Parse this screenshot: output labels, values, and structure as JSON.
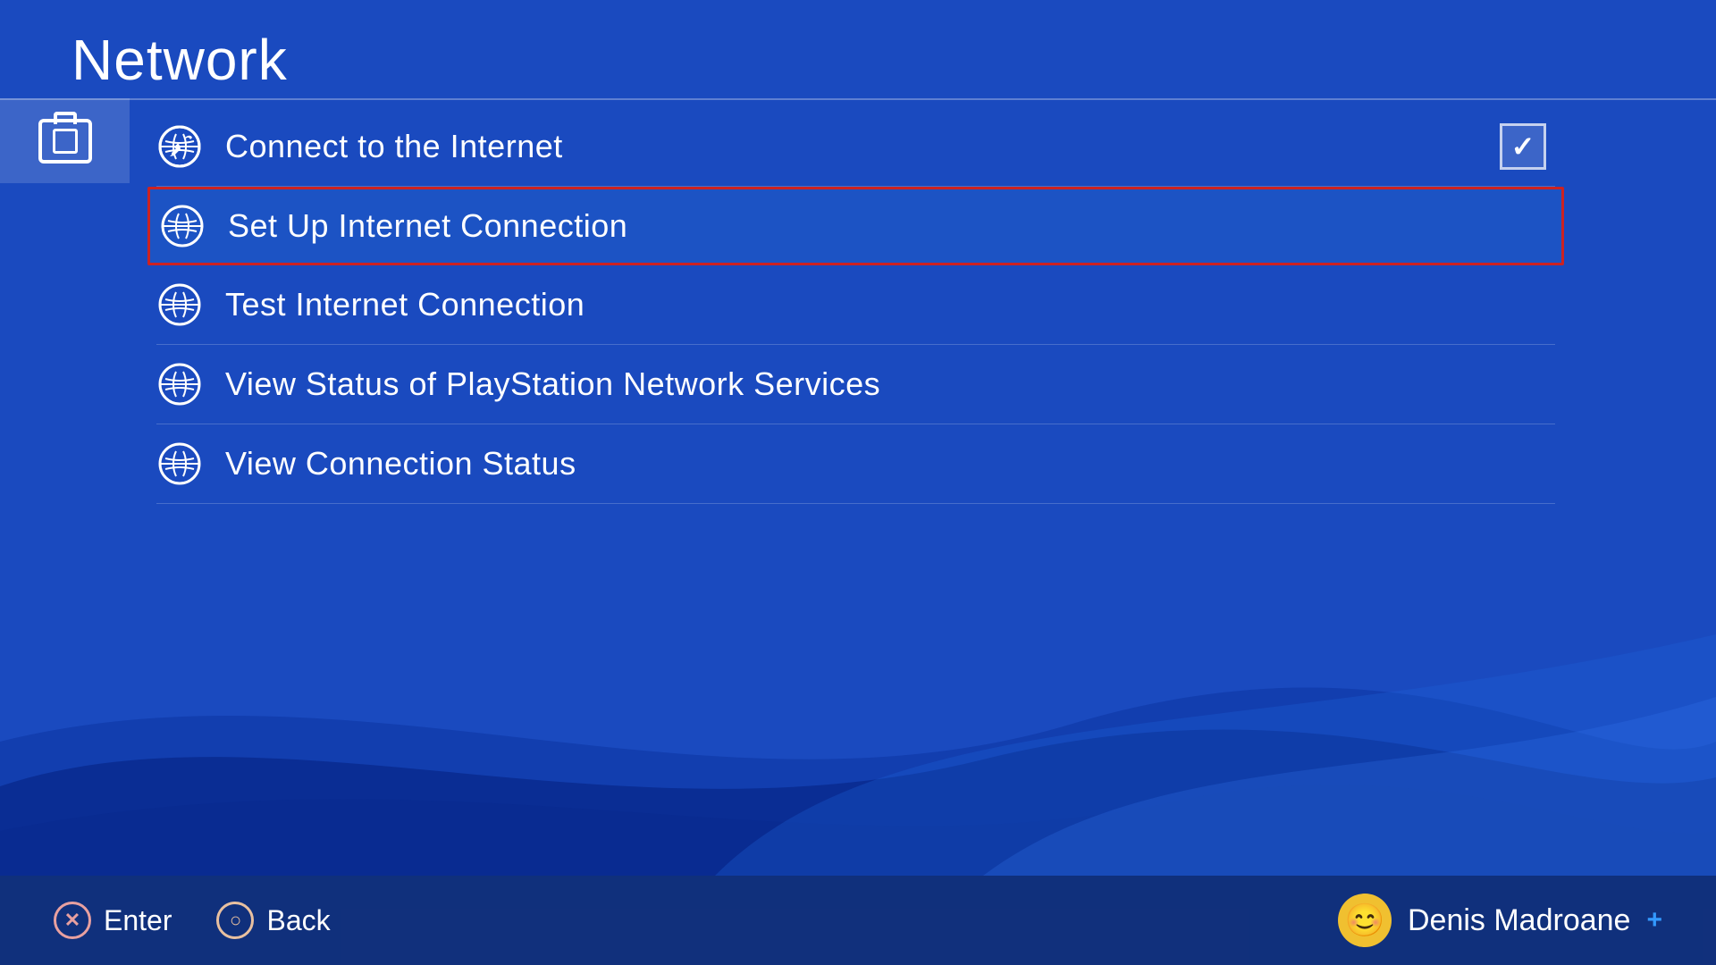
{
  "page": {
    "title": "Network",
    "background_color": "#1a4abf"
  },
  "menu": {
    "items": [
      {
        "id": "connect-internet",
        "label": "Connect to the Internet",
        "has_checkbox": true,
        "checked": true,
        "selected": false
      },
      {
        "id": "setup-internet",
        "label": "Set Up Internet Connection",
        "has_checkbox": false,
        "checked": false,
        "selected": true
      },
      {
        "id": "test-internet",
        "label": "Test Internet Connection",
        "has_checkbox": false,
        "checked": false,
        "selected": false
      },
      {
        "id": "psn-status",
        "label": "View Status of PlayStation Network Services",
        "has_checkbox": false,
        "checked": false,
        "selected": false
      },
      {
        "id": "connection-status",
        "label": "View Connection Status",
        "has_checkbox": false,
        "checked": false,
        "selected": false
      }
    ]
  },
  "bottom_bar": {
    "enter_label": "Enter",
    "back_label": "Back",
    "x_button": "✕",
    "o_button": "○",
    "username": "Denis Madroane",
    "avatar_emoji": "😊",
    "ps_plus": "+"
  }
}
